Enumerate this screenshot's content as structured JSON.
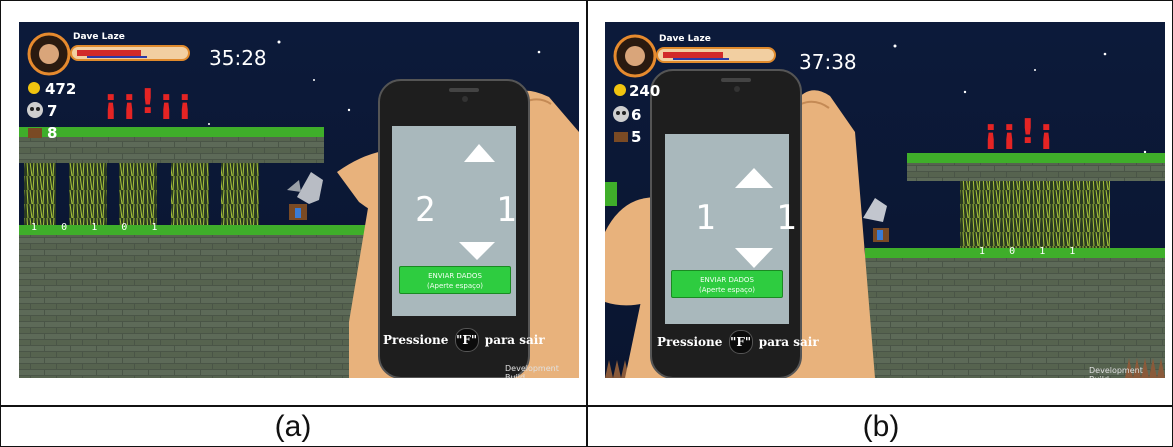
{
  "panels": [
    {
      "caption": "(a)",
      "player_name": "Dave Laze",
      "timer": "35:28",
      "coins": "472",
      "kills": "7",
      "chests": "8",
      "red_marks": "¡¡!¡¡",
      "bits_row": "1    0    1    0    1",
      "phone": {
        "digits": "2 1",
        "send_line1": "ENVIAR DADOS",
        "send_line2": "(Aperte espaço)"
      },
      "exit_prefix": "Pressione",
      "exit_key": "\"F\"",
      "exit_suffix": "para sair",
      "dev_build": "Development Build"
    },
    {
      "caption": "(b)",
      "player_name": "Dave Laze",
      "timer": "37:38",
      "coins": "240",
      "kills": "6",
      "chests": "5",
      "red_marks": "¡¡!¡",
      "bits_row": "1    0    1    1",
      "phone": {
        "digits": "1 1",
        "send_line1": "ENVIAR DADOS",
        "send_line2": "(Aperte espaço)"
      },
      "exit_prefix": "Pressione",
      "exit_key": "\"F\"",
      "exit_suffix": "para sair",
      "dev_build": "Development Build"
    }
  ],
  "colors": {
    "sky": "#0a1733",
    "grass": "#3fae2a",
    "stone": "#4d5a4a",
    "hand": "#e8b27c",
    "phone_body": "#1e1e1e",
    "send_button": "#2ecc40",
    "red_marks": "#e52424"
  },
  "icons": [
    "coin-icon",
    "skull-icon",
    "chest-icon",
    "hero-portrait-icon",
    "gargoyle-enemy-icon",
    "knight-player-icon",
    "arrow-up-icon",
    "arrow-down-icon"
  ]
}
